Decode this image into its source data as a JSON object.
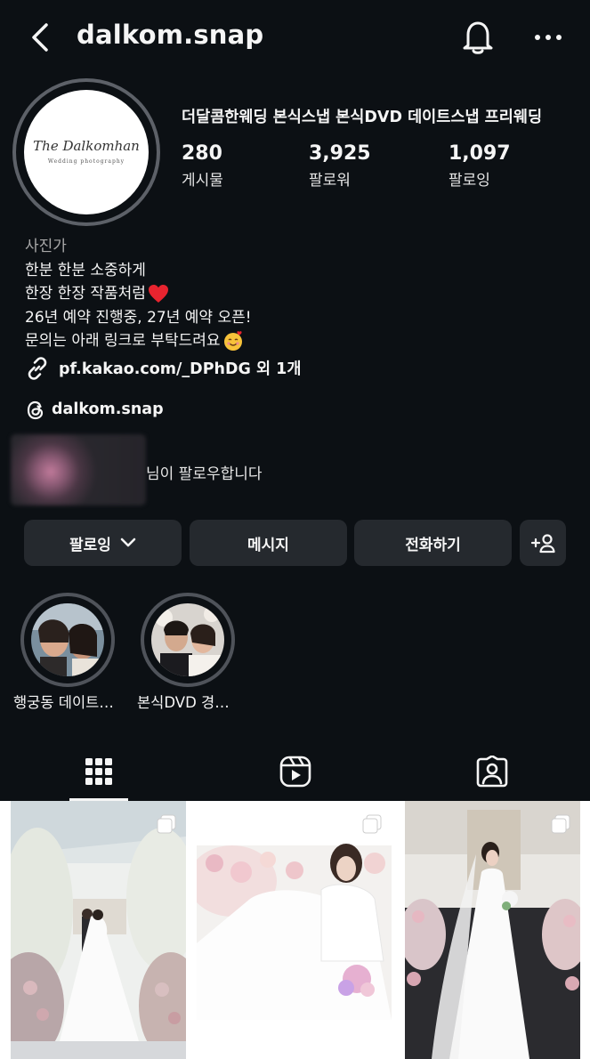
{
  "header": {
    "username": "dalkom.snap"
  },
  "profile": {
    "avatar_logo_text": "The Dalkomhan",
    "avatar_logo_sub": "Wedding photography",
    "full_name": "더달콤한웨딩 본식스냅 본식DVD 데이트스냅 프리웨딩",
    "stats": [
      {
        "value": "280",
        "label": "게시물"
      },
      {
        "value": "3,925",
        "label": "팔로워"
      },
      {
        "value": "1,097",
        "label": "팔로잉"
      }
    ],
    "category": "사진가",
    "bio_lines": [
      "한분 한분 소중하게",
      "한장 한장 작품처럼",
      "26년 예약 진행중, 27년 예약 오픈!",
      "문의는 아래 링크로 부탁드려요"
    ],
    "link_text": "pf.kakao.com/_DPhDG 외 1개",
    "threads_handle": "dalkom.snap",
    "followed_by_text": "님이 팔로우합니다"
  },
  "actions": {
    "following_label": "팔로잉",
    "message_label": "메시지",
    "call_label": "전화하기"
  },
  "highlights": [
    {
      "label": "행궁동 데이트…"
    },
    {
      "label": "본식DVD 경…"
    }
  ],
  "tabs": [
    "posts-grid-icon",
    "reels-icon",
    "tagged-icon"
  ],
  "colors": {
    "background": "#0c1014",
    "button": "#25292e",
    "secondary_text": "#a8a8a8"
  }
}
